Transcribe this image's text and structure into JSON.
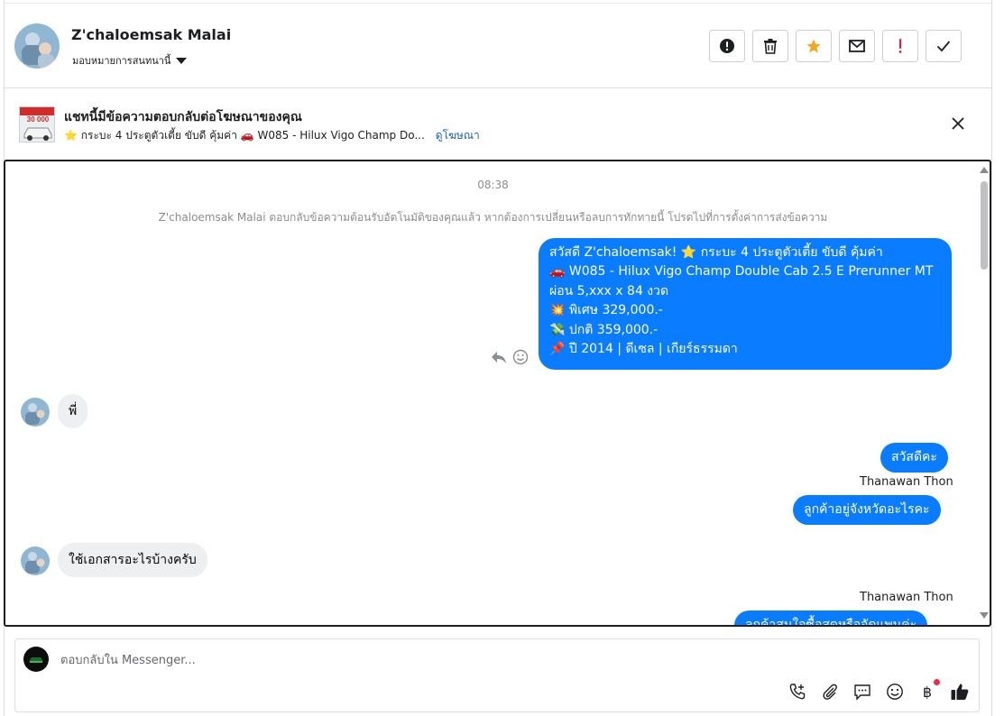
{
  "header": {
    "contact_name": "Z'chaloemsak Malai",
    "assign_label": "มอบหมายการสนทนานี้",
    "actions": [
      "spam-report",
      "delete",
      "star",
      "mark-unread",
      "follow-up",
      "done"
    ]
  },
  "ad_bar": {
    "thumb_text": "30 000",
    "title": "แชทนี้มีข้อความตอบกลับต่อโฆษณาของคุณ",
    "subtitle": "⭐ กระบะ 4 ประตูตัวเตี้ย ขับดี คุ้มค่า 🚗 W085 - Hilux Vigo Champ Do...",
    "view_ad_label": "ดูโฆษณา"
  },
  "thread": {
    "timestamp": "08:38",
    "auto_reply_notice": "Z'chaloemsak Malai ตอบกลับข้อความต้อนรับอัตโนมัติของคุณแล้ว หากต้องการเปลี่ยนหรือลบการทักทายนี้ โปรดไปที่การตั้งค่าการส่งข้อความ",
    "outgoing_greeting": [
      "สวัสดี Z'chaloemsak! ⭐ กระบะ 4 ประตูตัวเตี้ย ขับดี คุ้มค่า",
      "🚗 W085 - Hilux Vigo Champ Double Cab 2.5 E Prerunner MT",
      "ผ่อน 5,xxx x 84 งวด",
      "💥 พิเศษ 329,000.-",
      "💸 ปกติ 359,000.-",
      "📌 ปี 2014 | ดีเซล | เกียร์ธรรมดา"
    ],
    "incoming_1": "พี่",
    "outgoing_2": "สวัสดีคะ",
    "agent_name_1": "Thanawan Thon",
    "outgoing_3": "ลูกค้าอยู่จังหวัดอะไรคะ",
    "incoming_2": "ใช้เอกสารอะไรบ้างครับ",
    "agent_name_2": "Thanawan Thon",
    "outgoing_4": "ลูกค้าสนใจซื้อสดหรือจัดแพนค่ะ"
  },
  "composer": {
    "placeholder": "ตอบกลับใน Messenger...",
    "tools": [
      "call-icon",
      "attachment-icon",
      "saved-reply-icon",
      "emoji-icon",
      "baht-icon",
      "like-icon"
    ]
  },
  "colors": {
    "outgoing_bubble": "#0a7cff",
    "incoming_bubble": "#eeeff1",
    "link": "#1b5fb0",
    "star": "#f5a623",
    "alert": "#e41e3f"
  }
}
